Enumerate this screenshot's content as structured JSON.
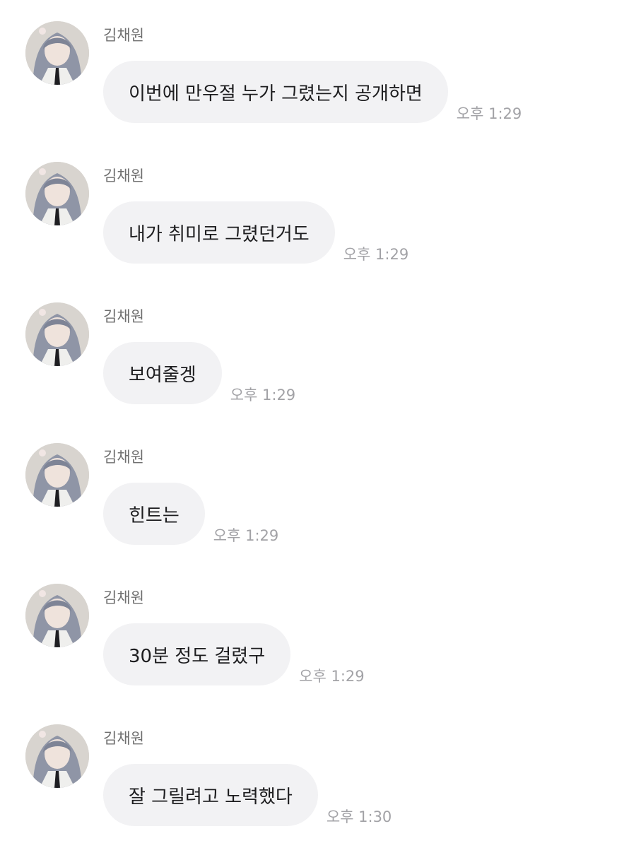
{
  "chat": {
    "messages": [
      {
        "sender": "김채원",
        "text": "이번에 만우절 누가 그렸는지 공개하면",
        "time": "오후 1:29",
        "avatar_icon": "profile-photo-icon"
      },
      {
        "sender": "김채원",
        "text": "내가 취미로 그렸던거도",
        "time": "오후 1:29",
        "avatar_icon": "profile-photo-icon"
      },
      {
        "sender": "김채원",
        "text": "보여줄겡",
        "time": "오후 1:29",
        "avatar_icon": "profile-photo-icon"
      },
      {
        "sender": "김채원",
        "text": "힌트는",
        "time": "오후 1:29",
        "avatar_icon": "profile-photo-icon"
      },
      {
        "sender": "김채원",
        "text": "30분 정도 걸렸구",
        "time": "오후 1:29",
        "avatar_icon": "profile-photo-icon"
      },
      {
        "sender": "김채원",
        "text": "잘 그릴려고 노력했다",
        "time": "오후 1:30",
        "avatar_icon": "profile-photo-icon"
      }
    ]
  },
  "colors": {
    "bubble_background": "#f2f2f4",
    "message_text": "#1d1d1f",
    "sender_text": "#6f6f6f",
    "timestamp_text": "#a2a2a6"
  }
}
